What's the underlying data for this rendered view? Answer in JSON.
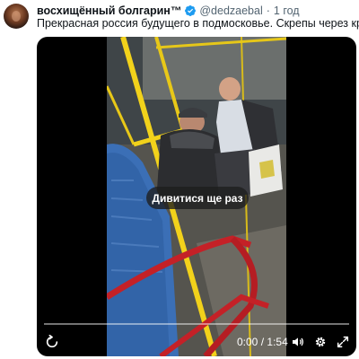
{
  "tweet": {
    "author_name": "восхищённый болгарин™",
    "author_handle": "@dedzaebal",
    "separator": "·",
    "time": "1 год",
    "text": "Прекрасная россия будущего в подмосковье. Скрепы через край"
  },
  "video": {
    "overlay_label": "Дивитися ще раз",
    "current_time": "0:00",
    "time_separator": "/",
    "duration": "1:54",
    "progress": 0,
    "controls": [
      "replay-icon",
      "volume-icon",
      "settings-gear-icon",
      "fullscreen-icon"
    ]
  },
  "colors": {
    "verified_badge": "#1d9bf0",
    "text_primary": "#0f1419",
    "text_secondary": "#536471",
    "rail_yellow": "#f2d21b",
    "rail_red": "#c42127",
    "seat_blue": "#3b6fb6"
  }
}
